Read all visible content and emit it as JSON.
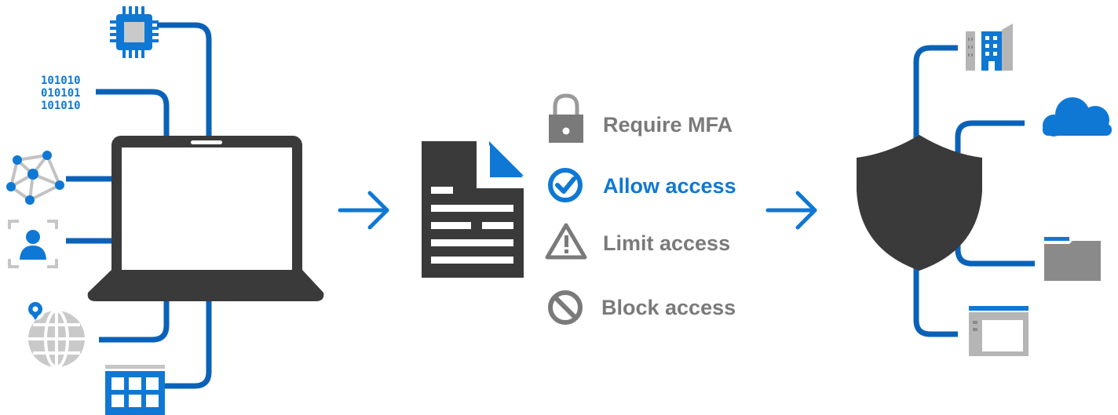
{
  "colors": {
    "blue": "#0a62b8",
    "accent_blue": "#0f78d4",
    "dark": "#3a3a3a",
    "gray": "#7a7a7a",
    "light_gray": "#bdbdbd",
    "white": "#ffffff"
  },
  "signals": {
    "binary_text": [
      "101010",
      "010101",
      "101010"
    ],
    "items": [
      {
        "icon": "cpu-chip-icon"
      },
      {
        "icon": "binary-data-icon"
      },
      {
        "icon": "network-nodes-icon"
      },
      {
        "icon": "user-identity-icon"
      },
      {
        "icon": "globe-location-icon"
      },
      {
        "icon": "app-grid-icon"
      }
    ],
    "device": {
      "icon": "laptop-icon"
    }
  },
  "policy": {
    "icon": "policy-document-icon"
  },
  "decisions": [
    {
      "label": "Require MFA",
      "icon": "padlock-icon",
      "color": "#7a7a7a"
    },
    {
      "label": "Allow access",
      "icon": "check-circle-icon",
      "color": "#0f78d4"
    },
    {
      "label": "Limit access",
      "icon": "warning-triangle-icon",
      "color": "#7a7a7a"
    },
    {
      "label": "Block access",
      "icon": "block-circle-icon",
      "color": "#7a7a7a"
    }
  ],
  "protected": {
    "shield": {
      "icon": "shield-icon"
    },
    "resources": [
      {
        "icon": "building-icon"
      },
      {
        "icon": "cloud-icon"
      },
      {
        "icon": "folder-icon"
      },
      {
        "icon": "app-window-icon"
      }
    ]
  },
  "flow_arrows": [
    {
      "icon": "arrow-right-icon"
    },
    {
      "icon": "arrow-right-icon"
    }
  ]
}
